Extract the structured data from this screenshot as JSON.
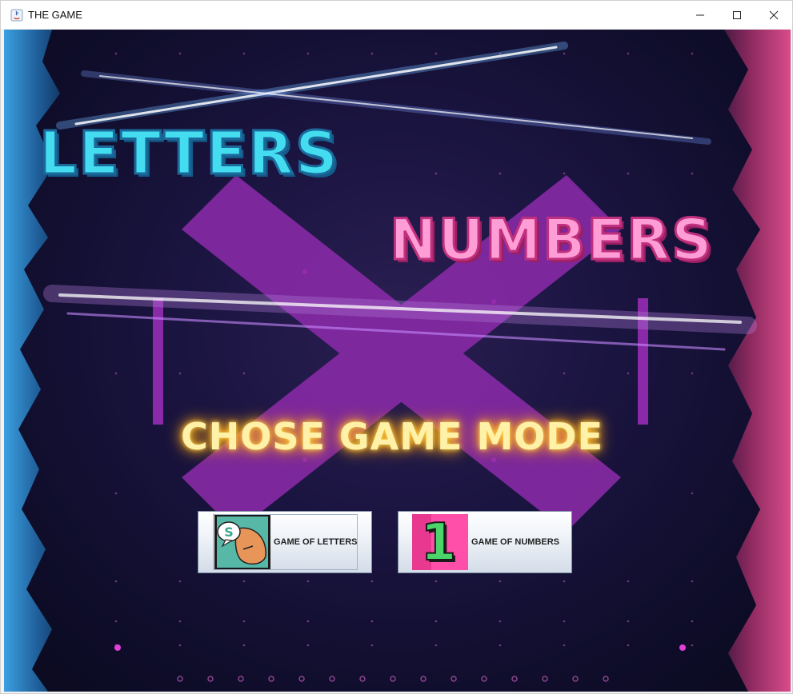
{
  "window": {
    "title": "THE GAME"
  },
  "titles": {
    "letters": "LETTERS",
    "numbers": "NUMBERS",
    "mode": "CHOSE GAME MODE"
  },
  "buttons": {
    "letters": {
      "label": "GAME OF LETTERS",
      "icon": "speech-bubble-face-icon",
      "icon_letter": "S"
    },
    "numbers": {
      "label": "GAME OF NUMBERS",
      "icon": "number-one-icon",
      "icon_digit": "1"
    }
  },
  "colors": {
    "letters_title": "#44dcef",
    "numbers_title": "#ff9ed6",
    "mode_title_glow": "#ffd54a",
    "x_shape": "#8a2aa8",
    "left_rock": "#2a7fc0",
    "right_rock": "#c23a78"
  }
}
